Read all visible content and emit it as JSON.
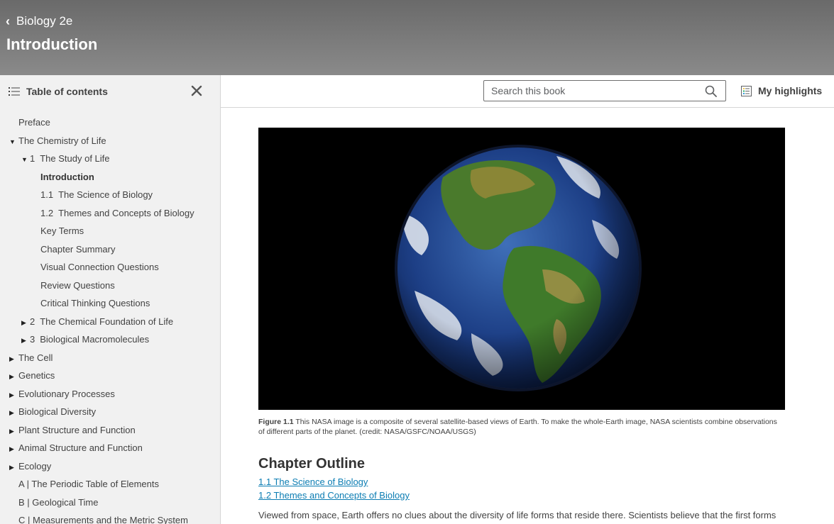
{
  "header": {
    "back_label": "Biology 2e",
    "title": "Introduction"
  },
  "sidebar": {
    "title": "Table of contents",
    "items": [
      {
        "label": "Preface",
        "level": 0
      },
      {
        "label": "The Chemistry of Life",
        "level": 0,
        "caret": "down"
      },
      {
        "num": "1",
        "label": "The Study of Life",
        "level": 1,
        "caret": "down"
      },
      {
        "label": "Introduction",
        "level": 2,
        "active": true
      },
      {
        "num": "1.1",
        "label": "The Science of Biology",
        "level": 2
      },
      {
        "num": "1.2",
        "label": "Themes and Concepts of Biology",
        "level": 2
      },
      {
        "label": "Key Terms",
        "level": 2
      },
      {
        "label": "Chapter Summary",
        "level": 2
      },
      {
        "label": "Visual Connection Questions",
        "level": 2
      },
      {
        "label": "Review Questions",
        "level": 2
      },
      {
        "label": "Critical Thinking Questions",
        "level": 2
      },
      {
        "num": "2",
        "label": "The Chemical Foundation of Life",
        "level": 1,
        "caret": "right"
      },
      {
        "num": "3",
        "label": "Biological Macromolecules",
        "level": 1,
        "caret": "right"
      },
      {
        "label": "The Cell",
        "level": 0,
        "caret": "right"
      },
      {
        "label": "Genetics",
        "level": 0,
        "caret": "right"
      },
      {
        "label": "Evolutionary Processes",
        "level": 0,
        "caret": "right"
      },
      {
        "label": "Biological Diversity",
        "level": 0,
        "caret": "right"
      },
      {
        "label": "Plant Structure and Function",
        "level": 0,
        "caret": "right"
      },
      {
        "label": "Animal Structure and Function",
        "level": 0,
        "caret": "right"
      },
      {
        "label": "Ecology",
        "level": 0,
        "caret": "right"
      },
      {
        "label": "A | The Periodic Table of Elements",
        "level": 0
      },
      {
        "label": "B | Geological Time",
        "level": 0
      },
      {
        "label": "C | Measurements and the Metric System",
        "level": 0
      }
    ]
  },
  "toolbar": {
    "search_placeholder": "Search this book",
    "highlights_label": "My highlights"
  },
  "main": {
    "figure_label": "Figure 1.1",
    "figure_caption": " This NASA image is a composite of several satellite-based views of Earth. To make the whole-Earth image, NASA scientists combine observations of different parts of the planet. (credit: NASA/GSFC/NOAA/USGS)",
    "chapter_outline_heading": "Chapter Outline",
    "outline_links": [
      "1.1 The Science of Biology",
      "1.2 Themes and Concepts of Biology"
    ],
    "intro_text": "Viewed from space, Earth offers no clues about the diversity of life forms that reside there. Scientists believe that the first forms of"
  },
  "colors": {
    "link": "#0c7db3",
    "header_top": "#6a6a6a",
    "sidebar_bg": "#f1f1f1"
  },
  "icons": [
    "chevron-left-icon",
    "toc-list-icon",
    "close-icon",
    "search-icon",
    "highlights-icon",
    "caret-down-icon",
    "caret-right-icon"
  ]
}
